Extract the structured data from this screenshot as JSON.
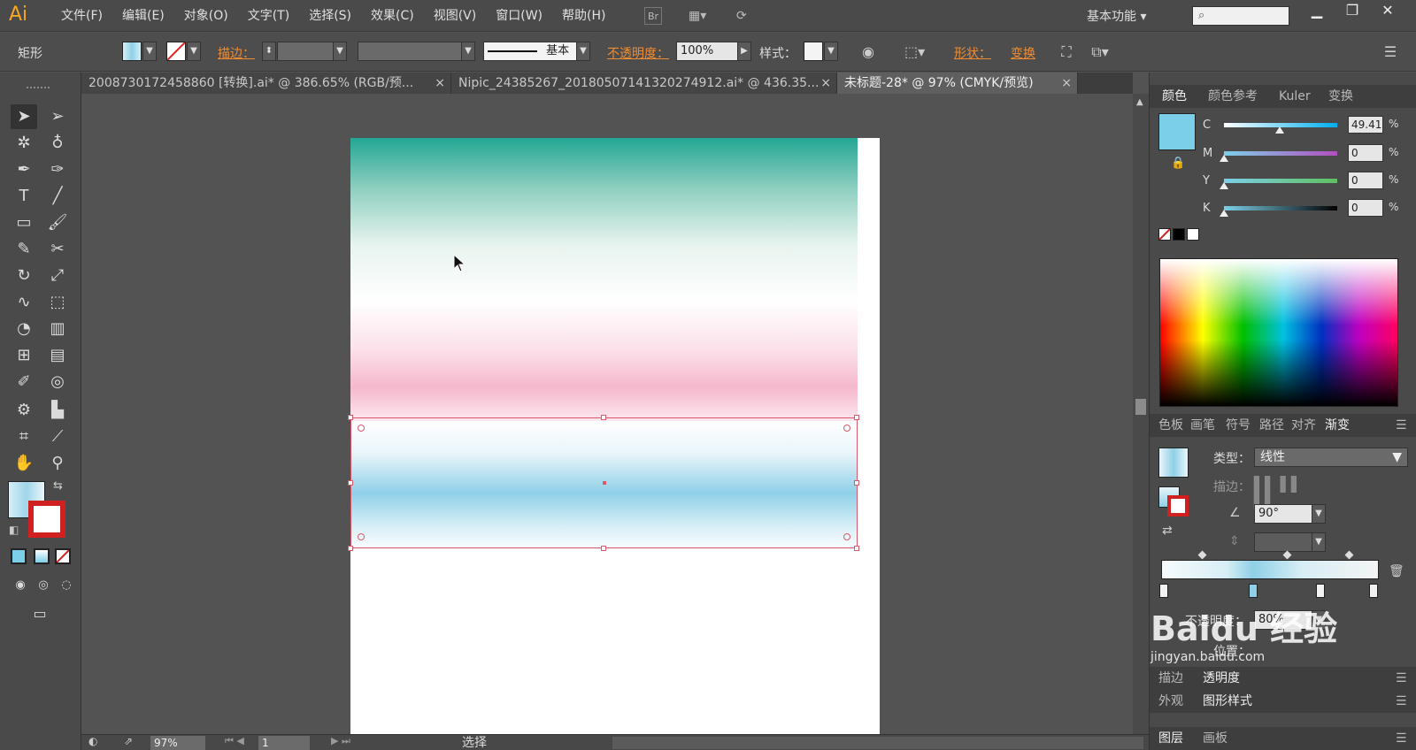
{
  "app": {
    "logo": "Ai"
  },
  "menu": [
    "文件(F)",
    "编辑(E)",
    "对象(O)",
    "文字(T)",
    "选择(S)",
    "效果(C)",
    "视图(V)",
    "窗口(W)",
    "帮助(H)"
  ],
  "menubar": {
    "bridge": "Br",
    "workspace": "基本功能",
    "search_placeholder": ""
  },
  "control": {
    "object_type": "矩形",
    "stroke_label": "描边：",
    "stroke_style": "基本",
    "opacity_label": "不透明度：",
    "opacity_value": "100%",
    "style_label": "样式：",
    "shape_label": "形状：",
    "transform_label": "变换"
  },
  "tabs": [
    {
      "label": "2008730172458860 [转换].ai* @ 386.65% (RGB/预...",
      "active": false
    },
    {
      "label": "Nipic_24385267_20180507141320274912.ai* @ 436.35...",
      "active": false
    },
    {
      "label": "未标题-28* @ 97% (CMYK/预览)",
      "active": true
    }
  ],
  "status": {
    "zoom": "97%",
    "page": "1",
    "mode": "选择"
  },
  "color_panel": {
    "tabs": [
      "颜色",
      "颜色参考",
      "Kuler",
      "变换"
    ],
    "active_tab": "颜色",
    "fill_color": "#7ccfe8",
    "channels": [
      {
        "name": "C",
        "value": "49.41",
        "unit": "%",
        "level": 0.49
      },
      {
        "name": "M",
        "value": "0",
        "unit": "%",
        "level": 0
      },
      {
        "name": "Y",
        "value": "0",
        "unit": "%",
        "level": 0
      },
      {
        "name": "K",
        "value": "0",
        "unit": "%",
        "level": 0
      }
    ]
  },
  "gradient_panel": {
    "tabs": [
      "色板",
      "画笔",
      "符号",
      "路径",
      "对齐",
      "渐变"
    ],
    "active_tab": "渐变",
    "type_label": "类型：",
    "type_value": "线性",
    "stroke_label": "描边：",
    "angle_value": "90°",
    "opacity_label": "不透明度：",
    "opacity_value": "80%",
    "location_label": "位置："
  },
  "bottom_panels": {
    "row1": [
      "描边",
      "透明度"
    ],
    "row2": [
      "外观",
      "图形样式"
    ],
    "row3": [
      "图层",
      "画板"
    ]
  },
  "watermark": {
    "line1": "Baidu 经验",
    "line2": "jingyan.baidu.com"
  }
}
